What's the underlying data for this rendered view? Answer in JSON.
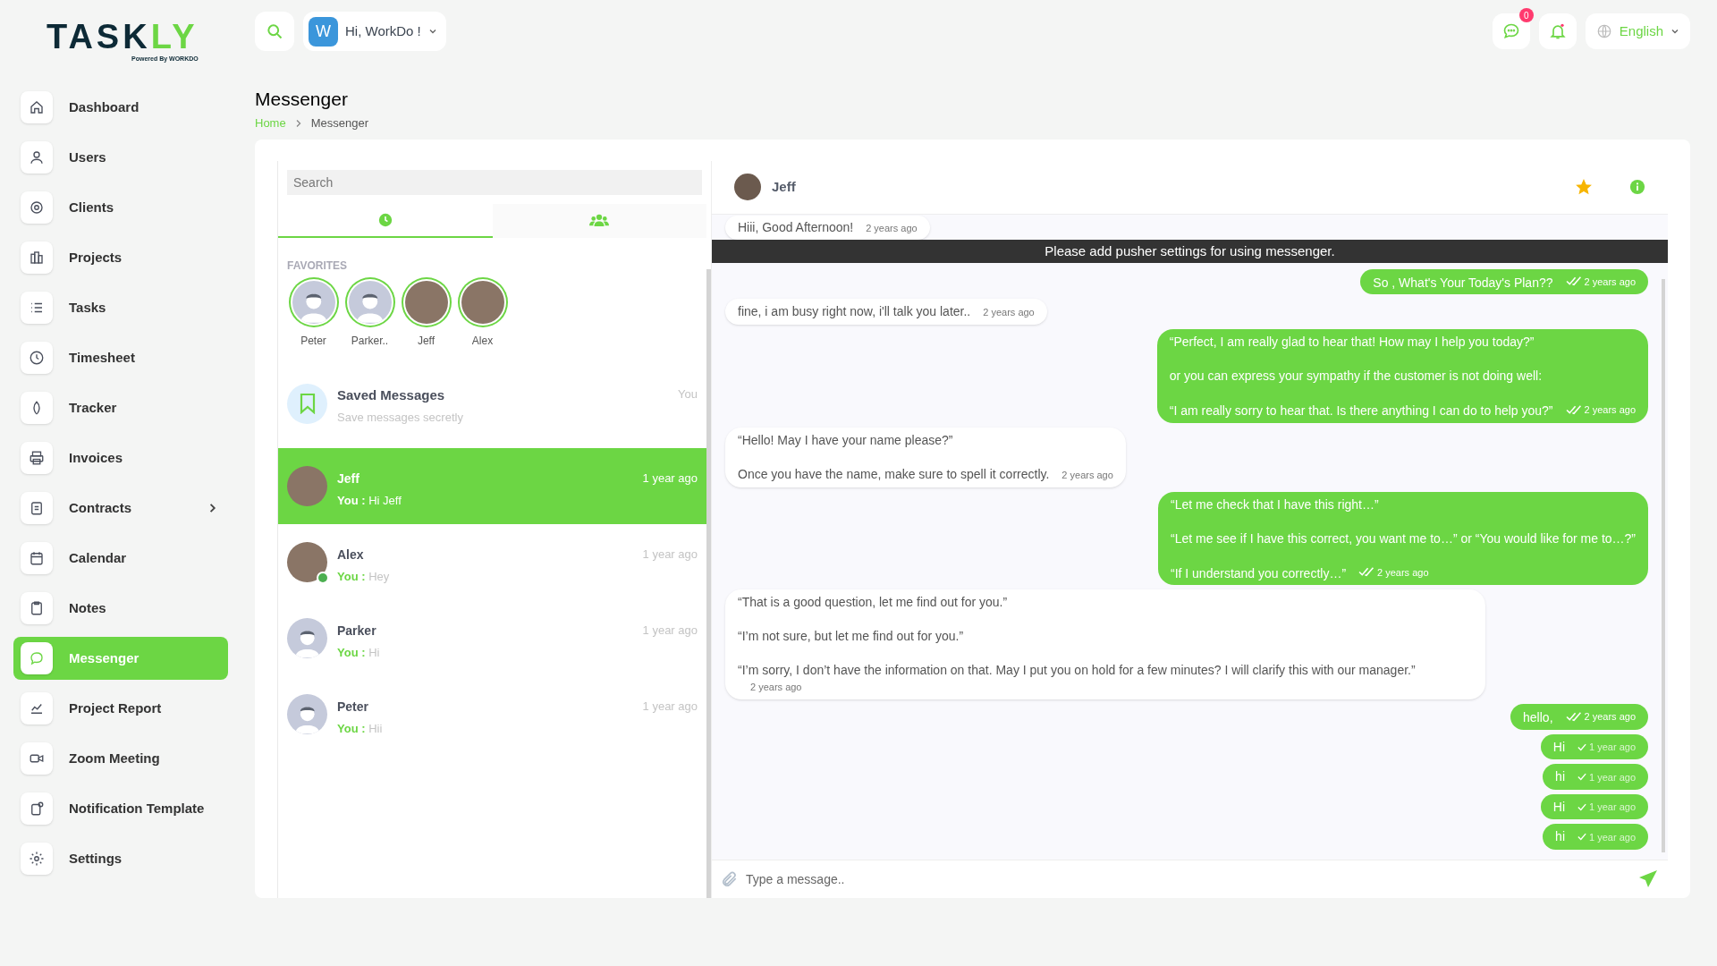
{
  "logo": {
    "name": "TASKLY",
    "tagline": "Powered By WORKDO"
  },
  "header": {
    "user_initial": "W",
    "greeting": "Hi, WorkDo !",
    "message_badge": "0",
    "language": "English"
  },
  "sidebar": {
    "items": [
      {
        "label": "Dashboard",
        "selected": false,
        "has_submenu": false
      },
      {
        "label": "Users",
        "selected": false,
        "has_submenu": false
      },
      {
        "label": "Clients",
        "selected": false,
        "has_submenu": false
      },
      {
        "label": "Projects",
        "selected": false,
        "has_submenu": false
      },
      {
        "label": "Tasks",
        "selected": false,
        "has_submenu": false
      },
      {
        "label": "Timesheet",
        "selected": false,
        "has_submenu": false
      },
      {
        "label": "Tracker",
        "selected": false,
        "has_submenu": false
      },
      {
        "label": "Invoices",
        "selected": false,
        "has_submenu": false
      },
      {
        "label": "Contracts",
        "selected": false,
        "has_submenu": true
      },
      {
        "label": "Calendar",
        "selected": false,
        "has_submenu": false
      },
      {
        "label": "Notes",
        "selected": false,
        "has_submenu": false
      },
      {
        "label": "Messenger",
        "selected": true,
        "has_submenu": false
      },
      {
        "label": "Project Report",
        "selected": false,
        "has_submenu": false
      },
      {
        "label": "Zoom Meeting",
        "selected": false,
        "has_submenu": false
      },
      {
        "label": "Notification Template",
        "selected": false,
        "has_submenu": false
      },
      {
        "label": "Settings",
        "selected": false,
        "has_submenu": false
      }
    ]
  },
  "page": {
    "title": "Messenger",
    "breadcrumb": [
      "Home",
      "Messenger"
    ]
  },
  "contacts_panel": {
    "search": {
      "placeholder": "Search"
    },
    "tabs": [
      {
        "kind": "recent",
        "selected": true
      },
      {
        "kind": "groups",
        "selected": false
      }
    ],
    "favorites_title": "FAVORITES",
    "favorites": [
      {
        "name": "Peter",
        "photo": false
      },
      {
        "name": "Parker..",
        "photo": false
      },
      {
        "name": "Jeff",
        "photo": true
      },
      {
        "name": "Alex",
        "photo": true
      }
    ],
    "saved": {
      "title": "Saved Messages",
      "subtitle": "Save messages secretly",
      "note": "You"
    },
    "conversations": [
      {
        "name": "Jeff",
        "sender": "You :",
        "preview": "Hi Jeff",
        "time": "1 year ago",
        "selected": true,
        "photo": true,
        "online": false
      },
      {
        "name": "Alex",
        "sender": "You :",
        "preview": "Hey",
        "time": "1 year ago",
        "selected": false,
        "photo": true,
        "online": true
      },
      {
        "name": "Parker",
        "sender": "You :",
        "preview": "Hi",
        "time": "1 year ago",
        "selected": false,
        "photo": false,
        "online": false
      },
      {
        "name": "Peter",
        "sender": "You :",
        "preview": "Hii",
        "time": "1 year ago",
        "selected": false,
        "photo": false,
        "online": false
      }
    ]
  },
  "chat": {
    "contact": "Jeff",
    "favorite": true,
    "banner": "Please add pusher settings for using messenger.",
    "messages": [
      {
        "kind": "received",
        "lines": [
          "Hiii, Good Afternoon!"
        ],
        "time": "2 years ago"
      },
      {
        "kind": "sent",
        "lines": [
          "So , What's Your Today's Plan??"
        ],
        "time": "2 years ago",
        "read": true
      },
      {
        "kind": "received",
        "lines": [
          "fine, i am busy right now, i'll talk you later.."
        ],
        "time": "2 years ago"
      },
      {
        "kind": "sent",
        "lines": [
          "“Perfect, I am really glad to hear that! How may I help you today?”",
          "or you can express your sympathy if the customer is not doing well:",
          "“I am really sorry to hear that. Is there anything I can do to help you?”"
        ],
        "time": "2 years ago",
        "read": true
      },
      {
        "kind": "received",
        "lines": [
          "“Hello! May I have your name please?”",
          "Once you have the name, make sure to spell it correctly."
        ],
        "time": "2 years ago"
      },
      {
        "kind": "sent",
        "lines": [
          "“Let me check that I have this right…”",
          "“Let me see if I have this correct, you want me to…” or “You would like for me to…?”",
          "“If I understand you correctly…”"
        ],
        "time": "2 years ago",
        "read": true
      },
      {
        "kind": "received",
        "lines": [
          "“That is a good question, let me find out for you.”",
          "“I’m not sure, but let me find out for you.”",
          "“I’m sorry, I don’t have the information on that. May I put you on hold for a few minutes? I will clarify this with our manager.”"
        ],
        "time": "2 years ago"
      },
      {
        "kind": "sent",
        "lines": [
          "hello,"
        ],
        "time": "2 years ago",
        "read": true
      },
      {
        "kind": "sent",
        "lines": [
          "Hi"
        ],
        "time": "1 year ago",
        "read": false
      },
      {
        "kind": "sent",
        "lines": [
          "hi"
        ],
        "time": "1 year ago",
        "read": false
      },
      {
        "kind": "sent",
        "lines": [
          "Hi"
        ],
        "time": "1 year ago",
        "read": false
      },
      {
        "kind": "sent",
        "lines": [
          "hi"
        ],
        "time": "1 year ago",
        "read": false
      }
    ],
    "input": {
      "placeholder": "Type a message.."
    }
  }
}
